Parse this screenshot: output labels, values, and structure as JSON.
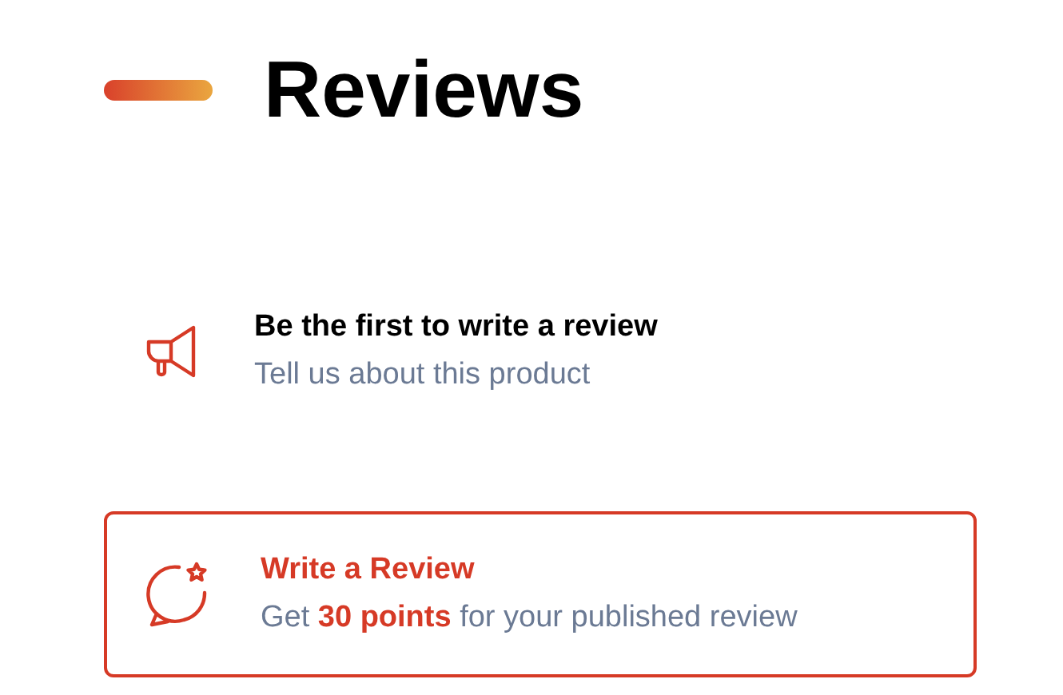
{
  "heading": "Reviews",
  "items": [
    {
      "kind": "plain",
      "title": "Be the first to write a review",
      "subtitle": "Tell us about this product"
    },
    {
      "kind": "card",
      "title": "Write a Review",
      "subtitle": "Get **30 points** for your published review"
    }
  ]
}
